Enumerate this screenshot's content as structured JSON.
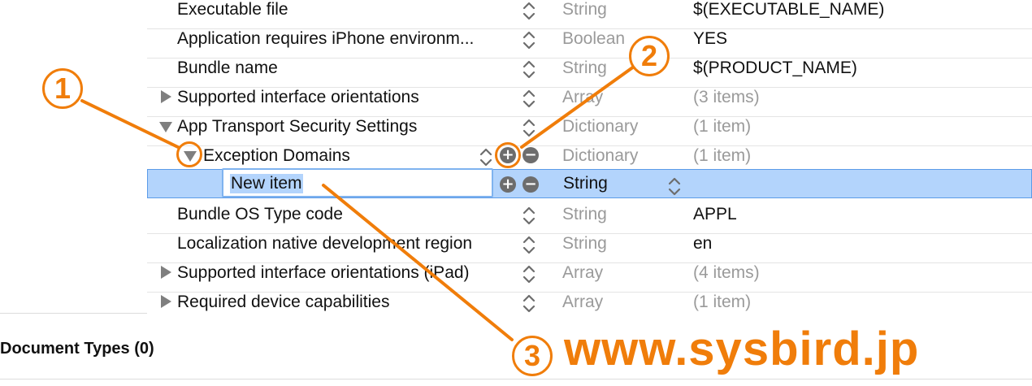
{
  "plist": {
    "rows": [
      {
        "key": "Executable file",
        "type": "String",
        "value": "$(EXECUTABLE_NAME)"
      },
      {
        "key": "Application requires iPhone environm...",
        "type": "Boolean",
        "value": "YES"
      },
      {
        "key": "Bundle name",
        "type": "String",
        "value": "$(PRODUCT_NAME)"
      },
      {
        "key": "Supported interface orientations",
        "type": "Array",
        "value": "(3 items)"
      },
      {
        "key": "App Transport Security Settings",
        "type": "Dictionary",
        "value": "(1 item)"
      },
      {
        "key": "Exception Domains",
        "type": "Dictionary",
        "value": "(1 item)"
      },
      {
        "key": "New item",
        "type": "String",
        "value": ""
      },
      {
        "key": "Bundle OS Type code",
        "type": "String",
        "value": "APPL"
      },
      {
        "key": "Localization native development region",
        "type": "String",
        "value": "en"
      },
      {
        "key": "Supported interface orientations (iPad)",
        "type": "Array",
        "value": "(4 items)"
      },
      {
        "key": "Required device capabilities",
        "type": "Array",
        "value": "(1 item)"
      }
    ]
  },
  "section": {
    "document_types": "Document Types (0)"
  },
  "annotations": {
    "callout_1": "1",
    "callout_2": "2",
    "callout_3": "3",
    "brand_text": "www.sysbird.jp",
    "accent_color": "#f07d0a"
  },
  "colors": {
    "selection": "#b3d4fc",
    "muted_text": "#9a9a9a"
  }
}
